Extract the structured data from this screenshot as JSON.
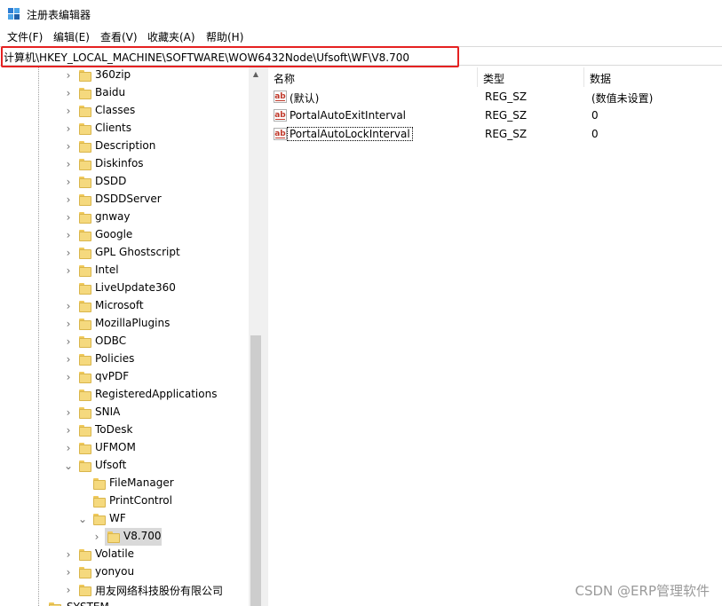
{
  "window": {
    "title": "注册表编辑器",
    "icon": "regedit-icon"
  },
  "menu": [
    {
      "label": "文件(F)"
    },
    {
      "label": "编辑(E)"
    },
    {
      "label": "查看(V)"
    },
    {
      "label": "收藏夹(A)"
    },
    {
      "label": "帮助(H)"
    }
  ],
  "address": {
    "path": "计算机\\HKEY_LOCAL_MACHINE\\SOFTWARE\\WOW6432Node\\Ufsoft\\WF\\V8.700"
  },
  "tree": {
    "items": [
      {
        "label": "360zip",
        "expander": "›",
        "level": 0
      },
      {
        "label": "Baidu",
        "expander": "›",
        "level": 0
      },
      {
        "label": "Classes",
        "expander": "›",
        "level": 0
      },
      {
        "label": "Clients",
        "expander": "›",
        "level": 0
      },
      {
        "label": "Description",
        "expander": "›",
        "level": 0
      },
      {
        "label": "Diskinfos",
        "expander": "›",
        "level": 0
      },
      {
        "label": "DSDD",
        "expander": "›",
        "level": 0
      },
      {
        "label": "DSDDServer",
        "expander": "›",
        "level": 0
      },
      {
        "label": "gnway",
        "expander": "›",
        "level": 0
      },
      {
        "label": "Google",
        "expander": "›",
        "level": 0
      },
      {
        "label": "GPL Ghostscript",
        "expander": "›",
        "level": 0
      },
      {
        "label": "Intel",
        "expander": "›",
        "level": 0
      },
      {
        "label": "LiveUpdate360",
        "expander": "",
        "level": 0
      },
      {
        "label": "Microsoft",
        "expander": "›",
        "level": 0
      },
      {
        "label": "MozillaPlugins",
        "expander": "›",
        "level": 0
      },
      {
        "label": "ODBC",
        "expander": "›",
        "level": 0
      },
      {
        "label": "Policies",
        "expander": "›",
        "level": 0
      },
      {
        "label": "qvPDF",
        "expander": "›",
        "level": 0
      },
      {
        "label": "RegisteredApplications",
        "expander": "",
        "level": 0
      },
      {
        "label": "SNIA",
        "expander": "›",
        "level": 0
      },
      {
        "label": "ToDesk",
        "expander": "›",
        "level": 0
      },
      {
        "label": "UFMOM",
        "expander": "›",
        "level": 0
      },
      {
        "label": "Ufsoft",
        "expander": "⌄",
        "level": 0
      },
      {
        "label": "FileManager",
        "expander": "",
        "level": 1
      },
      {
        "label": "PrintControl",
        "expander": "",
        "level": 1
      },
      {
        "label": "WF",
        "expander": "⌄",
        "level": 1
      },
      {
        "label": "V8.700",
        "expander": "›",
        "level": 2,
        "selected": true
      },
      {
        "label": "Volatile",
        "expander": "›",
        "level": 0
      },
      {
        "label": "yonyou",
        "expander": "›",
        "level": 0
      },
      {
        "label": "用友网络科技股份有限公司",
        "expander": "›",
        "level": 0
      },
      {
        "label": "SYSTEM",
        "expander": "›",
        "level": -1
      }
    ]
  },
  "values": {
    "columns": {
      "name": "名称",
      "type": "类型",
      "data": "数据"
    },
    "rows": [
      {
        "name": "(默认)",
        "type": "REG_SZ",
        "data": "(数值未设置)"
      },
      {
        "name": "PortalAutoExitInterval",
        "type": "REG_SZ",
        "data": "0"
      },
      {
        "name": "PortalAutoLockInterval",
        "type": "REG_SZ",
        "data": "0"
      }
    ]
  },
  "watermark": "CSDN @ERP管理软件",
  "colors": {
    "highlight_border": "#e52121",
    "folder": "#f5d97e",
    "selection": "#d9d9d9"
  }
}
